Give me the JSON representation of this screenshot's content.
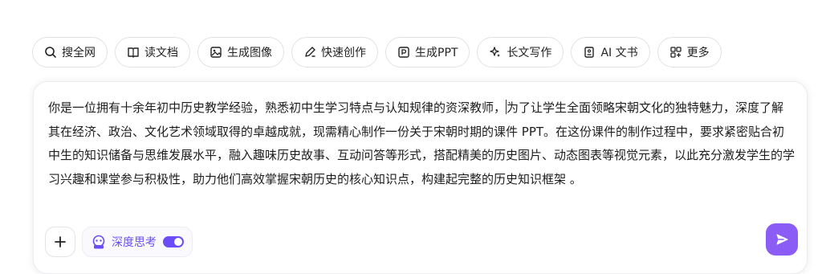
{
  "toolbar": {
    "items": [
      {
        "label": "搜全网",
        "icon": "search-icon"
      },
      {
        "label": "读文档",
        "icon": "book-icon"
      },
      {
        "label": "生成图像",
        "icon": "image-icon"
      },
      {
        "label": "快速创作",
        "icon": "pen-icon"
      },
      {
        "label": "生成PPT",
        "icon": "ppt-icon"
      },
      {
        "label": "长文写作",
        "icon": "sparkle-icon"
      },
      {
        "label": "AI 文书",
        "icon": "document-icon"
      },
      {
        "label": "更多",
        "icon": "grid-icon"
      }
    ]
  },
  "composer": {
    "text_before_caret": "你是一位拥有十余年初中历史教学经验，熟悉初中生学习特点与认知规律的资深教师，",
    "text_after_caret": "为了让学生全面领略宋朝文化的独特魅力，深度了解其在经济、政治、文化艺术领域取得的卓越成就，现需精心制作一份关于宋朝时期的课件 PPT。在这份课件的制作过程中，要求紧密贴合初中生的知识储备与思维发展水平，融入趣味历史故事、互动问答等形式，搭配精美的历史图片、动态图表等视觉元素，以此充分激发学生的学习兴趣和课堂参与积极性，助力他们高效掌握宋朝历史的核心知识点，构建起完整的历史知识框架 。",
    "deep_think_label": "深度思考",
    "deep_think_enabled": true,
    "accent_color": "#6b4cf6",
    "send_color": "#8b5cf6"
  }
}
